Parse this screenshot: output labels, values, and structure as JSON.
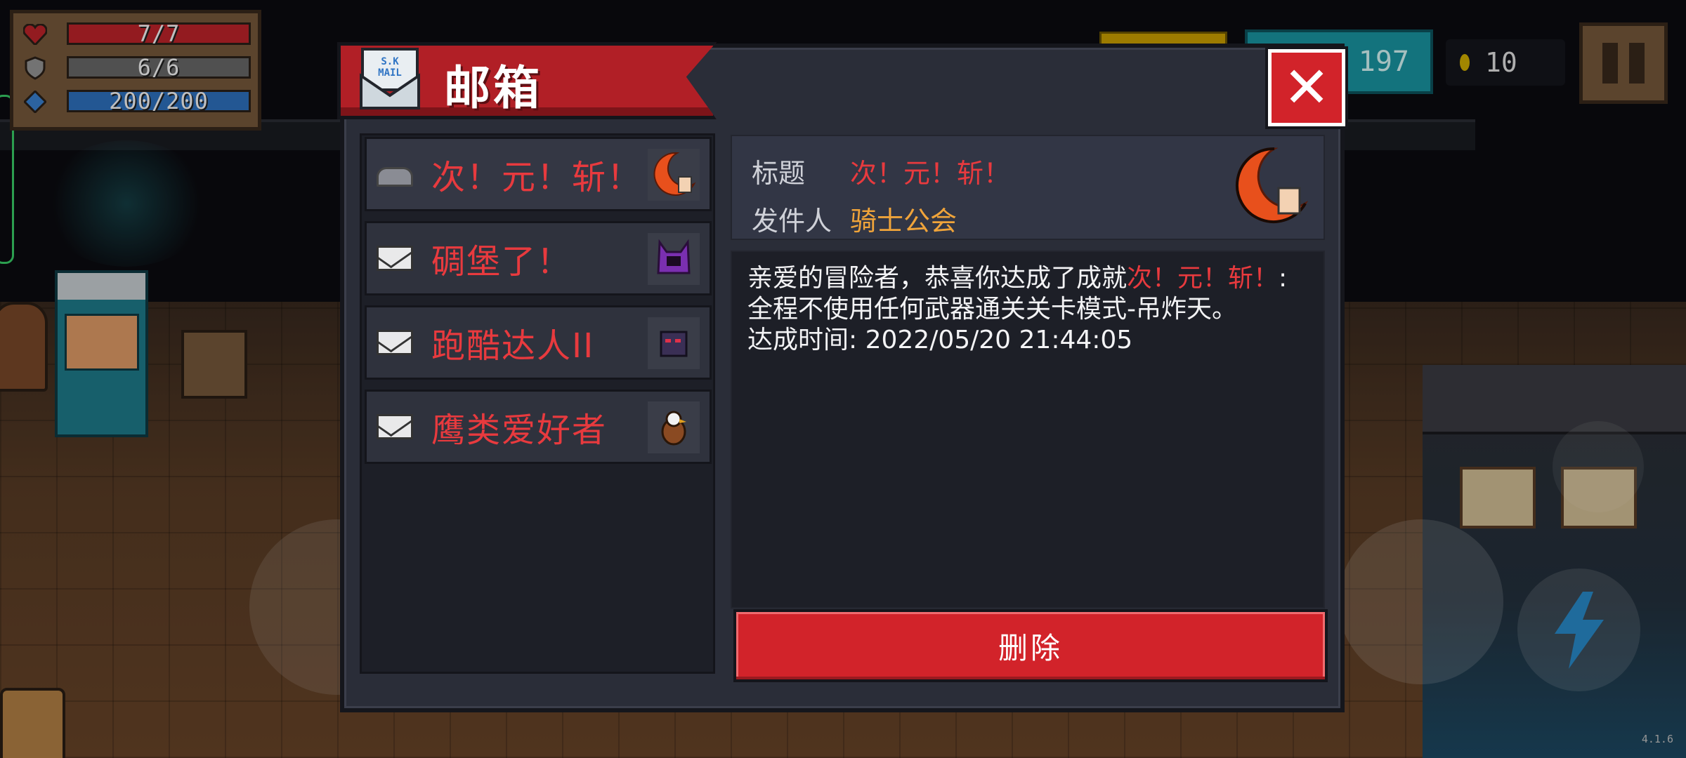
{
  "hud": {
    "hp": "7/7",
    "shield": "6/6",
    "energy": "200/200",
    "gems": "197",
    "coins": "10",
    "icons": [
      "heart-icon",
      "shield-icon",
      "energy-gem-icon",
      "coin-icon",
      "pause-icon"
    ]
  },
  "mailbox": {
    "title": "邮箱",
    "icon_text": "S.K MAIL",
    "close_label": "✕",
    "items": [
      {
        "label": "次！元！斩！",
        "read": true,
        "icon": "crescent-blade-icon"
      },
      {
        "label": "碉堡了！",
        "read": false,
        "icon": "purple-demon-icon"
      },
      {
        "label": "跑酷达人II",
        "read": false,
        "icon": "shadow-ninja-icon"
      },
      {
        "label": "鹰类爱好者",
        "read": false,
        "icon": "eagle-icon"
      }
    ],
    "detail": {
      "subject_label": "标题",
      "subject": "次！元！斩！",
      "sender_label": "发件人",
      "sender": "骑士公会",
      "body_prefix": "亲爱的冒险者，恭喜你达成了成就",
      "body_highlight": "次！元！斩！",
      "body_suffix": ":全程不使用任何武器通关关卡模式-吊炸天。",
      "time_line": "达成时间: 2022/05/20 21:44:05"
    },
    "delete_label": "删除"
  },
  "version": "4.1.6",
  "colors": {
    "accent_red": "#d2232a",
    "text_red": "#e83a3e",
    "sender_orange": "#f0a43a",
    "panel": "#2a2d38"
  }
}
